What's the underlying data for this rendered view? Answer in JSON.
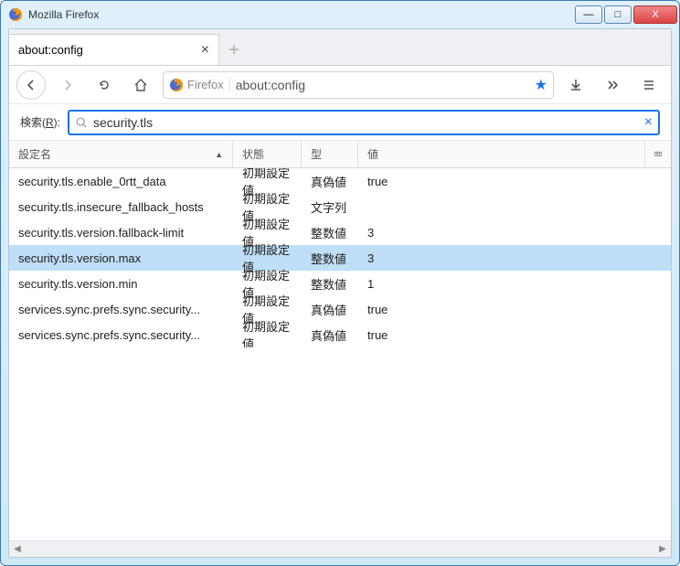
{
  "window": {
    "title": "Mozilla Firefox"
  },
  "tab": {
    "label": "about:config"
  },
  "urlbar": {
    "brand": "Firefox",
    "url": "about:config"
  },
  "search": {
    "label_prefix": "検索(",
    "label_key": "R",
    "label_suffix": "):",
    "value": "security.tls"
  },
  "columns": {
    "name": "設定名",
    "status": "状態",
    "type": "型",
    "value": "値"
  },
  "rows": [
    {
      "name": "security.tls.enable_0rtt_data",
      "status": "初期設定値",
      "type": "真偽値",
      "value": "true",
      "selected": false
    },
    {
      "name": "security.tls.insecure_fallback_hosts",
      "status": "初期設定値",
      "type": "文字列",
      "value": "",
      "selected": false
    },
    {
      "name": "security.tls.version.fallback-limit",
      "status": "初期設定値",
      "type": "整数値",
      "value": "3",
      "selected": false
    },
    {
      "name": "security.tls.version.max",
      "status": "初期設定値",
      "type": "整数値",
      "value": "3",
      "selected": true
    },
    {
      "name": "security.tls.version.min",
      "status": "初期設定値",
      "type": "整数値",
      "value": "1",
      "selected": false
    },
    {
      "name": "services.sync.prefs.sync.security...",
      "status": "初期設定値",
      "type": "真偽値",
      "value": "true",
      "selected": false
    },
    {
      "name": "services.sync.prefs.sync.security...",
      "status": "初期設定値",
      "type": "真偽値",
      "value": "true",
      "selected": false
    }
  ]
}
